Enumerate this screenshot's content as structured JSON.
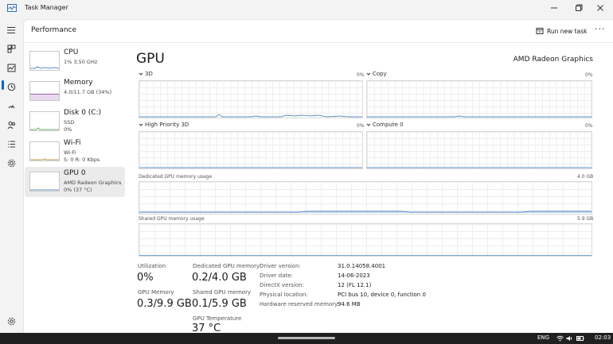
{
  "window": {
    "title": "Task Manager"
  },
  "header": {
    "page_title": "Performance",
    "run_task_label": "Run new task",
    "more_label": "···"
  },
  "resources": [
    {
      "name": "CPU",
      "sub1": "1% 3,50 GHz",
      "sub2": ""
    },
    {
      "name": "Memory",
      "sub1": "4.0/11.7 GB (34%)",
      "sub2": ""
    },
    {
      "name": "Disk 0 (C:)",
      "sub1": "SSD",
      "sub2": "0%"
    },
    {
      "name": "Wi-Fi",
      "sub1": "Wi-Fi",
      "sub2": "S: 0 R: 0 Kbps"
    },
    {
      "name": "GPU 0",
      "sub1": "AMD Radeon Graphics",
      "sub2": "0% (37 °C)"
    }
  ],
  "gpu": {
    "title": "GPU",
    "model": "AMD Radeon Graphics",
    "engines": [
      {
        "label": "3D",
        "percent": "0%"
      },
      {
        "label": "Copy",
        "percent": "0%"
      },
      {
        "label": "High Priority 3D",
        "percent": "0%"
      },
      {
        "label": "Compute 0",
        "percent": "0%"
      }
    ],
    "dedicated_label": "Dedicated GPU memory usage",
    "dedicated_max": "4.0 GB",
    "shared_label": "Shared GPU memory usage",
    "shared_max": "5.9 GB",
    "stats": {
      "utilization_label": "Utilization",
      "utilization_value": "0%",
      "gpu_memory_label": "GPU Memory",
      "gpu_memory_value": "0.3/9.9 GB",
      "dedicated_label": "Dedicated GPU memory",
      "dedicated_value": "0.2/4.0 GB",
      "shared_label": "Shared GPU memory",
      "shared_value": "0.1/5.9 GB",
      "temp_label": "GPU Temperature",
      "temp_value": "37 °C"
    },
    "info": [
      {
        "label": "Driver version:",
        "value": "31.0.14058.4001"
      },
      {
        "label": "Driver date:",
        "value": "14-06-2023"
      },
      {
        "label": "DirectX version:",
        "value": "12 (FL 12.1)"
      },
      {
        "label": "Physical location:",
        "value": "PCI bus 10, device 0, function 0"
      },
      {
        "label": "Hardware reserved memory:",
        "value": "94.6 MB"
      }
    ]
  },
  "taskbar": {
    "language": "ENG",
    "time": "02:03"
  },
  "colors": {
    "accent": "#0067c0",
    "gpu_line": "#2a6fb0",
    "memory_fill": "#a9c8e6"
  }
}
